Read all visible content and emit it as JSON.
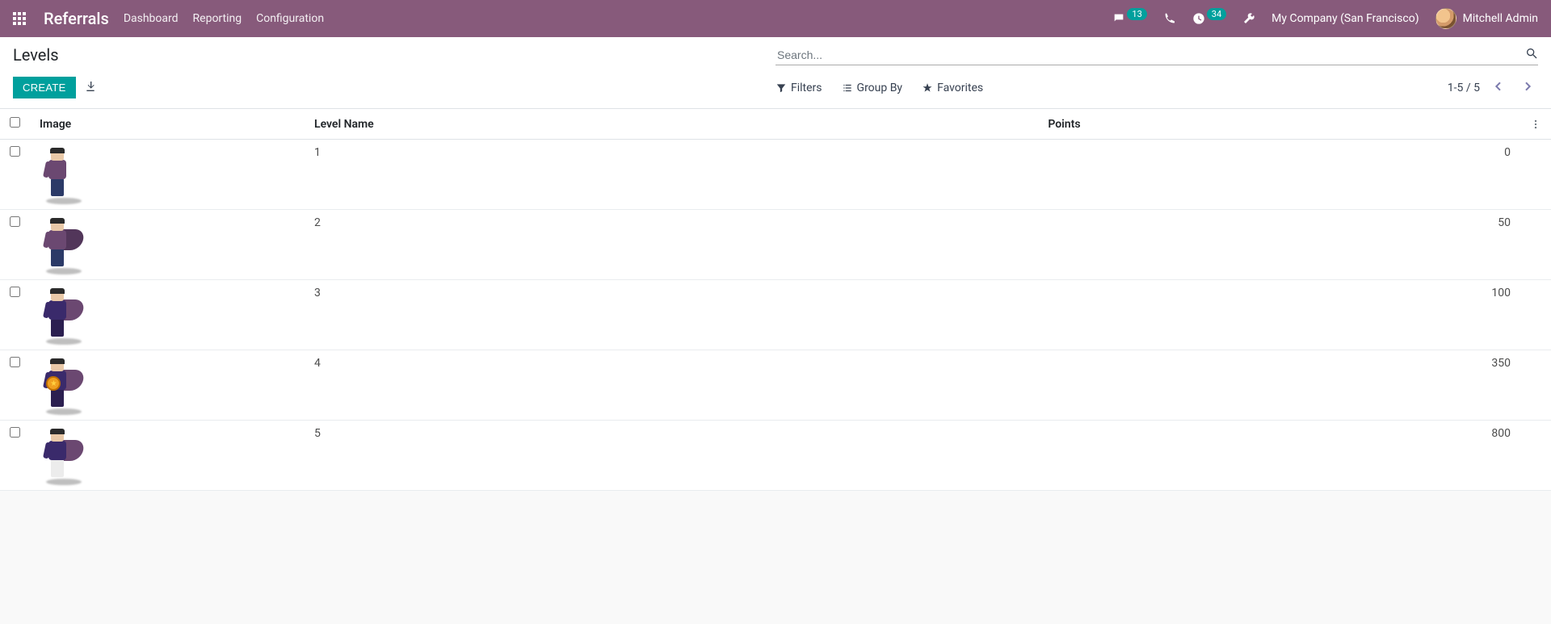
{
  "header": {
    "brand": "Referrals",
    "nav": [
      "Dashboard",
      "Reporting",
      "Configuration"
    ],
    "messages_badge": "13",
    "activities_badge": "34",
    "company": "My Company (San Francisco)",
    "user": "Mitchell Admin"
  },
  "control": {
    "title": "Levels",
    "create": "CREATE",
    "search_placeholder": "Search...",
    "filters": "Filters",
    "groupby": "Group By",
    "favorites": "Favorites",
    "pager": "1-5 / 5"
  },
  "columns": {
    "image": "Image",
    "name": "Level Name",
    "points": "Points"
  },
  "rows": [
    {
      "name": "1",
      "points": "0",
      "variant": "v1",
      "cape": false,
      "shield": false
    },
    {
      "name": "2",
      "points": "50",
      "variant": "v2",
      "cape": true,
      "shield": false
    },
    {
      "name": "3",
      "points": "100",
      "variant": "v3",
      "cape": true,
      "shield": false
    },
    {
      "name": "4",
      "points": "350",
      "variant": "v4",
      "cape": true,
      "shield": true
    },
    {
      "name": "5",
      "points": "800",
      "variant": "v5",
      "cape": true,
      "shield": false
    }
  ]
}
